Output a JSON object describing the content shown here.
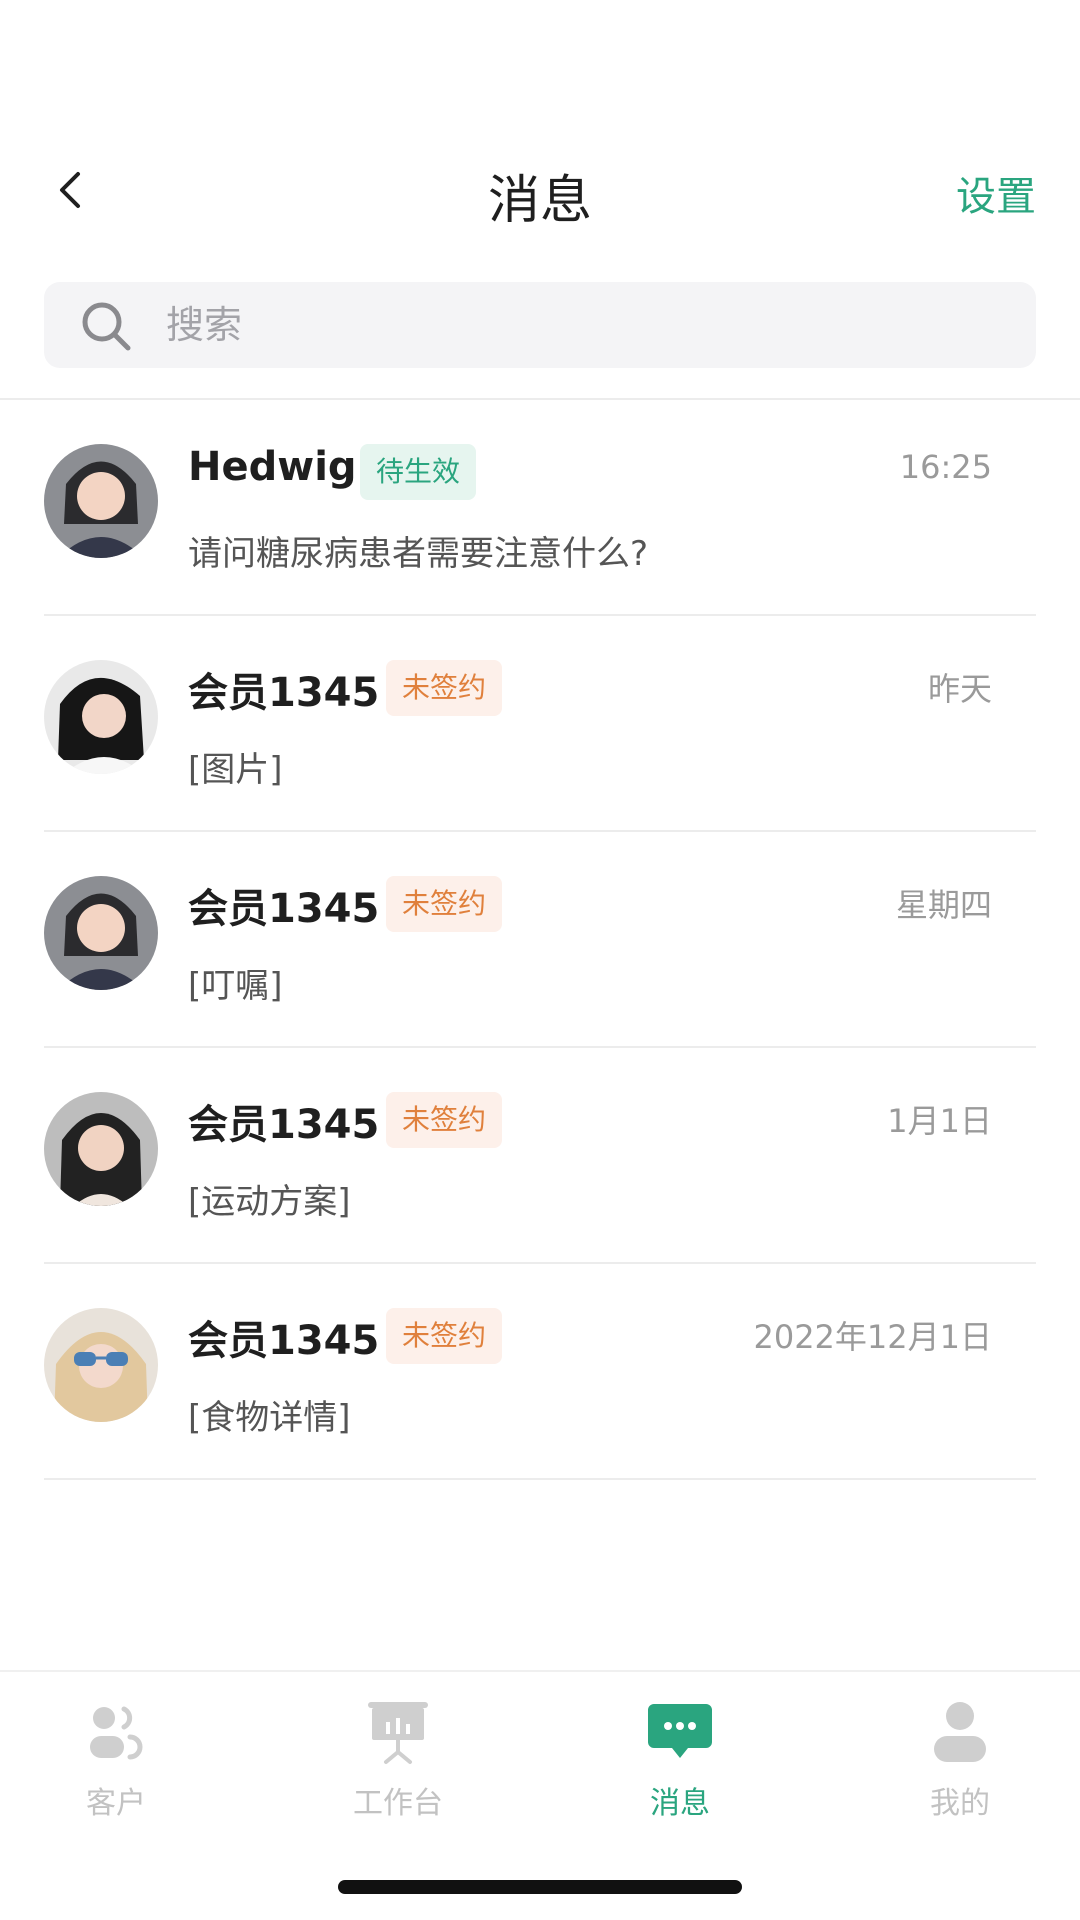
{
  "header": {
    "title": "消息",
    "settings_label": "设置"
  },
  "search": {
    "placeholder": "搜索"
  },
  "messages": [
    {
      "name": "Hedwig",
      "tag": "待生效",
      "tag_color": "#2aa57f",
      "time": "16:25",
      "preview": "请问糖尿病患者需要注意什么?"
    },
    {
      "name": "会员1345",
      "tag": "未签约",
      "tag_color": "#e0803c",
      "time": "昨天",
      "preview": "[图片]"
    },
    {
      "name": "会员1345",
      "tag": "未签约",
      "tag_color": "#e0803c",
      "time": "星期四",
      "preview": "[叮嘱]"
    },
    {
      "name": "会员1345",
      "tag": "未签约",
      "tag_color": "#e0803c",
      "time": "1月1日",
      "preview": "[运动方案]"
    },
    {
      "name": "会员1345",
      "tag": "未签约",
      "tag_color": "#e0803c",
      "time": "2022年12月1日",
      "preview": "[食物详情]"
    }
  ],
  "bottom_nav": [
    {
      "label": "客户",
      "icon": "customers-icon",
      "active": false
    },
    {
      "label": "工作台",
      "icon": "workbench-icon",
      "active": false
    },
    {
      "label": "消息",
      "icon": "messages-icon",
      "active": true
    },
    {
      "label": "我的",
      "icon": "profile-icon",
      "active": false
    }
  ],
  "colors": {
    "accent": "#2aa57f",
    "warning": "#e0803c"
  }
}
